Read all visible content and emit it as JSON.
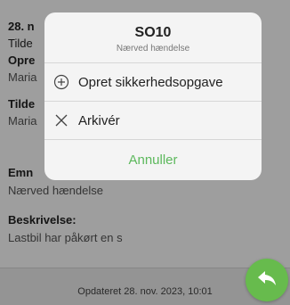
{
  "background": {
    "date_fragment": "28. n",
    "fields": [
      {
        "label": "Tilde",
        "value": null
      },
      {
        "label": "Opre",
        "value": "Maria"
      },
      {
        "label": "Tilde",
        "value": "Maria"
      },
      {
        "label": "Emn",
        "value": "Nærved hændelse"
      },
      {
        "label": "Beskrivelse:",
        "value": "Lastbil har påkørt en s"
      }
    ],
    "updated_text": "Opdateret 28. nov. 2023, 10:01"
  },
  "sheet": {
    "title": "SO10",
    "subtitle": "Nærved hændelse",
    "actions": [
      {
        "label": "Opret sikkerhedsopgave",
        "icon": "plus-circle-icon"
      },
      {
        "label": "Arkivér",
        "icon": "close-icon"
      }
    ],
    "cancel_label": "Annuller"
  },
  "fab": {
    "icon": "reply-arrow-icon"
  },
  "colors": {
    "accent": "#67bb4d",
    "cancel": "#5cb85c"
  }
}
